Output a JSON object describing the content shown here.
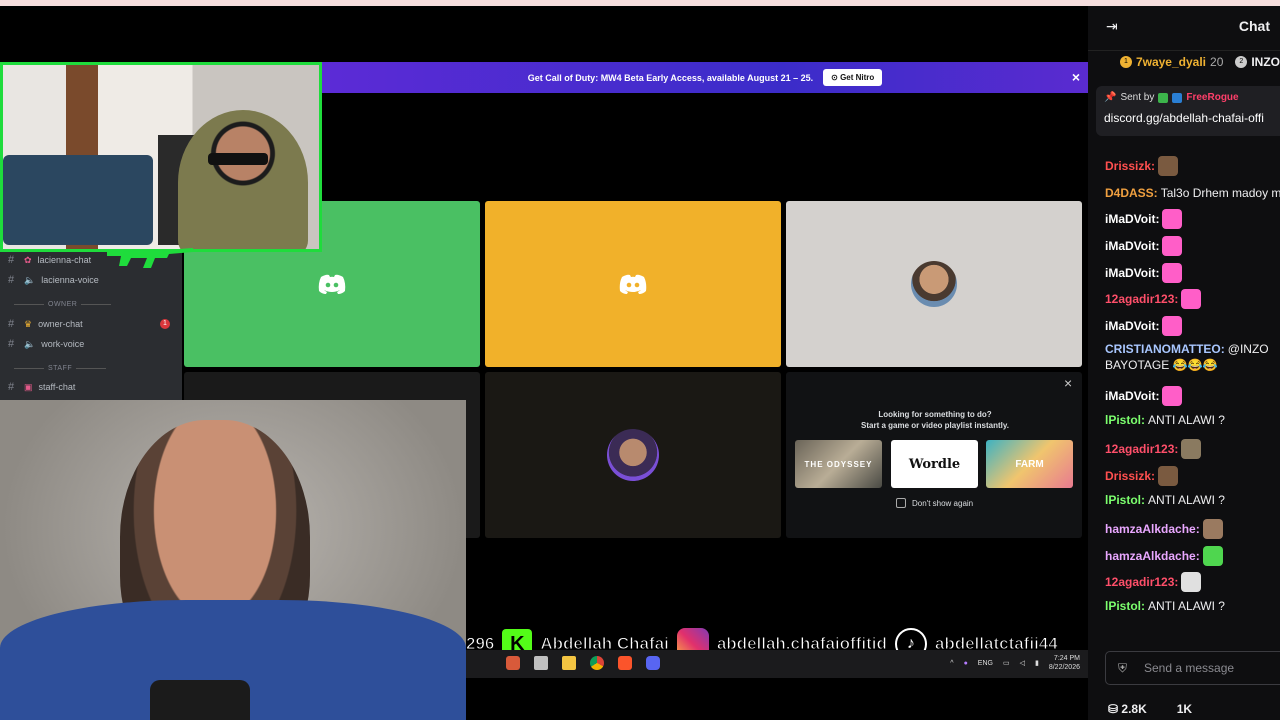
{
  "banner": {
    "text": "Get Call of Duty: MW4 Beta Early Access, available August 21 – 25.",
    "button": "Get Nitro",
    "close": "×"
  },
  "sidebar": {
    "channels": [
      {
        "label": "lacienna-chat",
        "type": "text"
      },
      {
        "label": "lacienna-voice",
        "type": "voice"
      },
      {
        "label": "owner-chat",
        "type": "text",
        "badge": "1"
      },
      {
        "label": "work-voice",
        "type": "voice"
      },
      {
        "label": "staff-chat",
        "type": "text"
      }
    ],
    "categories": [
      "OWNER",
      "STAFF"
    ]
  },
  "activity": {
    "title_line1": "Looking for something to do?",
    "title_line2": "Start a game or video playlist instantly.",
    "games": [
      "THE ODYSSEY",
      "Wordle",
      "FARM"
    ],
    "dont_show": "Don't show again",
    "close": "×"
  },
  "ticker": {
    "count": "296",
    "name": "Abdellah Chafai",
    "instagram": "abdellah.chafaioffitid",
    "tiktok": "abdellatctafii44"
  },
  "taskbar": {
    "lang": "ENG",
    "time": "7:24 PM",
    "date": "8/22/2026"
  },
  "chat": {
    "title": "Chat",
    "gifters": [
      {
        "rank": "1",
        "name": "7waye_dyali",
        "count": "20"
      },
      {
        "rank": "2",
        "name": "INZO"
      }
    ],
    "pinned": {
      "sent_by": "Sent by",
      "sender": "FreeRogue",
      "link": "discord.gg/abdellah-chafai-offi"
    },
    "messages": [
      {
        "user": "Drissizk",
        "text": "",
        "color": "#ff4f4f"
      },
      {
        "user": "D4DASS",
        "text": "Tal3o Drhem madoy m",
        "color": "#f0a040"
      },
      {
        "user": "iMaDVoit",
        "text": "",
        "color": "#ffffff"
      },
      {
        "user": "iMaDVoit",
        "text": "",
        "color": "#ffffff"
      },
      {
        "user": "iMaDVoit",
        "text": "",
        "color": "#ffffff"
      },
      {
        "user": "12agadir123",
        "text": "",
        "color": "#ff4f6a"
      },
      {
        "user": "iMaDVoit",
        "text": "",
        "color": "#ffffff"
      },
      {
        "user": "CRISTIANOMATTEO",
        "text": "@INZO",
        "color": "#a9c7ff"
      },
      {
        "user": "",
        "text": "BAYOTAGE 😂😂😂",
        "color": "#ffffff"
      },
      {
        "user": "iMaDVoit",
        "text": "",
        "color": "#ffffff"
      },
      {
        "user": "lPistol",
        "text": "ANTI ALAWI ?",
        "color": "#7cff6e"
      },
      {
        "user": "12agadir123",
        "text": "",
        "color": "#ff4f6a"
      },
      {
        "user": "Drissizk",
        "text": "",
        "color": "#ff4f4f"
      },
      {
        "user": "lPistol",
        "text": "ANTI ALAWI ?",
        "color": "#7cff6e"
      },
      {
        "user": "hamzaAlkdache",
        "text": "",
        "color": "#e9a7ff"
      },
      {
        "user": "hamzaAlkdache",
        "text": "",
        "color": "#e9a7ff"
      },
      {
        "user": "12agadir123",
        "text": "",
        "color": "#ff4f6a"
      },
      {
        "user": "lPistol",
        "text": "ANTI ALAWI ?",
        "color": "#7cff6e"
      }
    ],
    "input_placeholder": "Send a message",
    "footer": {
      "points": "2.8K",
      "viewers": "1K"
    }
  }
}
